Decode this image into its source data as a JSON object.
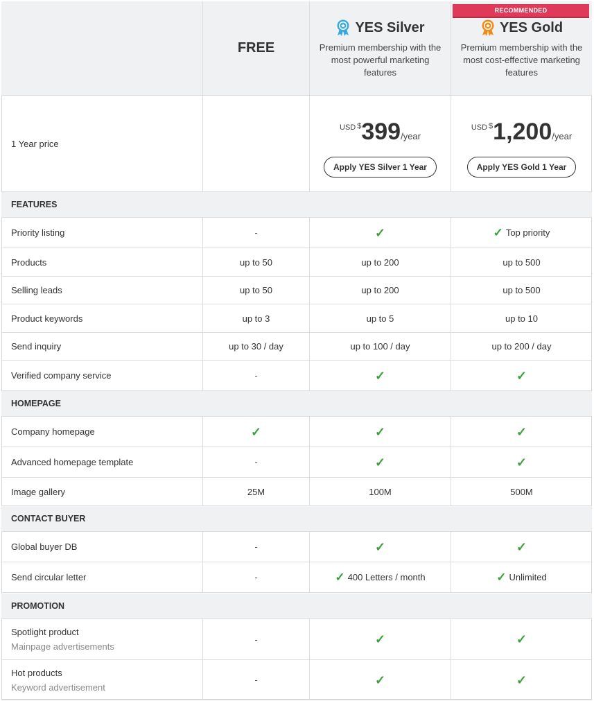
{
  "colors": {
    "check": "#3aa13a",
    "recommended_bg": "#e03a5a",
    "header_bg": "#f0f1f2",
    "silver_badge": "#39a9e0",
    "gold_badge": "#f28a1a"
  },
  "plans": {
    "free": {
      "name": "FREE"
    },
    "silver": {
      "name": "YES Silver",
      "icon": "silver-medal-icon",
      "description": "Premium membership with the most powerful marketing features",
      "currency": "USD",
      "symbol": "$",
      "price": "399",
      "per": "/year",
      "button": "Apply YES Silver 1 Year"
    },
    "gold": {
      "badge": "RECOMMENDED",
      "name": "YES Gold",
      "icon": "gold-medal-icon",
      "description": "Premium membership with the most cost-effective marketing features",
      "currency": "USD",
      "symbol": "$",
      "price": "1,200",
      "per": "/year",
      "button": "Apply YES Gold 1 Year"
    }
  },
  "price_row_label": "1 Year price",
  "sections": {
    "features": {
      "title": "FEATURES",
      "rows": [
        {
          "label": "Priority listing",
          "free": "-",
          "silver": "check",
          "gold": "Top priority"
        },
        {
          "label": "Products",
          "free": "up to 50",
          "silver": "up to 200",
          "gold": "up to 500"
        },
        {
          "label": "Selling leads",
          "free": "up to 50",
          "silver": "up to 200",
          "gold": "up to 500"
        },
        {
          "label": "Product keywords",
          "free": "up to 3",
          "silver": "up to 5",
          "gold": "up to 10"
        },
        {
          "label": "Send inquiry",
          "free": "up to 30 / day",
          "silver": "up to 100 / day",
          "gold": "up to 200 / day"
        },
        {
          "label": "Verified company service",
          "free": "-",
          "silver": "check",
          "gold": "check"
        }
      ]
    },
    "homepage": {
      "title": "HOMEPAGE",
      "rows": [
        {
          "label": "Company homepage",
          "free": "check",
          "silver": "check",
          "gold": "check"
        },
        {
          "label": "Advanced homepage template",
          "free": "-",
          "silver": "check",
          "gold": "check"
        },
        {
          "label": "Image gallery",
          "free": "25M",
          "silver": "100M",
          "gold": "500M"
        }
      ]
    },
    "contact": {
      "title": "CONTACT BUYER",
      "rows": [
        {
          "label": "Global buyer DB",
          "free": "-",
          "silver": "check",
          "gold": "check"
        },
        {
          "label": "Send circular letter",
          "free": "-",
          "silver": "400 Letters / month",
          "gold": "Unlimited"
        }
      ]
    },
    "promotion": {
      "title": "PROMOTION",
      "rows": [
        {
          "label": "Spotlight product",
          "sub": "Mainpage advertisements",
          "free": "-",
          "silver": "check",
          "gold": "check"
        },
        {
          "label": "Hot products",
          "sub": "Keyword advertisement",
          "free": "-",
          "silver": "check",
          "gold": "check"
        }
      ]
    }
  },
  "check_glyph": "✓"
}
